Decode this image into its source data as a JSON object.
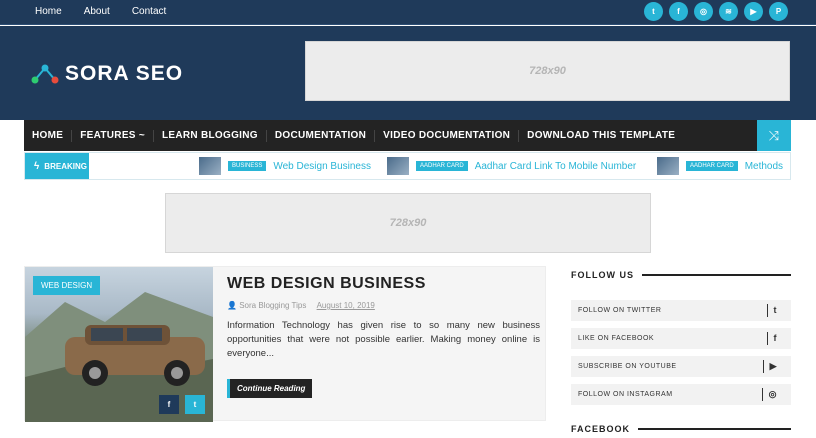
{
  "topnav": {
    "items": [
      "Home",
      "About",
      "Contact"
    ]
  },
  "social_icons": [
    "twitter-icon",
    "facebook-icon",
    "instagram-icon",
    "rss-icon",
    "youtube-icon",
    "pinterest-icon"
  ],
  "social_glyphs": [
    "t",
    "f",
    "◎",
    "≋",
    "▶",
    "P"
  ],
  "logo": {
    "text": "SORA SEO"
  },
  "ads": {
    "top": "728x90",
    "middle": "728x90"
  },
  "mainnav": {
    "items": [
      "HOME",
      "FEATURES ~",
      "LEARN BLOGGING",
      "DOCUMENTATION",
      "VIDEO DOCUMENTATION",
      "DOWNLOAD THIS TEMPLATE"
    ],
    "shuffle": "⤨"
  },
  "breaking": {
    "label": "BREAKING",
    "items": [
      {
        "badge": "BUSINESS",
        "title": "Web Design Business"
      },
      {
        "badge": "AADHAR CARD",
        "title": "Aadhar Card Link To Mobile Number"
      },
      {
        "badge": "AADHAR CARD",
        "title": "Methods"
      }
    ]
  },
  "post": {
    "category": "WEB DESIGN",
    "title": "WEB DESIGN BUSINESS",
    "author": "Sora Blogging Tips",
    "date": "August 10, 2019",
    "excerpt": "Information Technology has given rise to so many new business opportunities that were not possible earlier. Making money online is everyone...",
    "read_more": "Continue Reading",
    "share": [
      "f",
      "t"
    ]
  },
  "sidebar": {
    "follow_title": "FOLLOW US",
    "follow_items": [
      {
        "label": "FOLLOW ON TWITTER",
        "icon": "t"
      },
      {
        "label": "LIKE ON FACEBOOK",
        "icon": "f"
      },
      {
        "label": "SUBSCRIBE ON YOUTUBE",
        "icon": "▶"
      },
      {
        "label": "FOLLOW ON INSTAGRAM",
        "icon": "◎"
      }
    ],
    "facebook_title": "FACEBOOK"
  },
  "colors": {
    "navy": "#1f3a5a",
    "accent": "#29b5d6",
    "dark": "#232323"
  }
}
